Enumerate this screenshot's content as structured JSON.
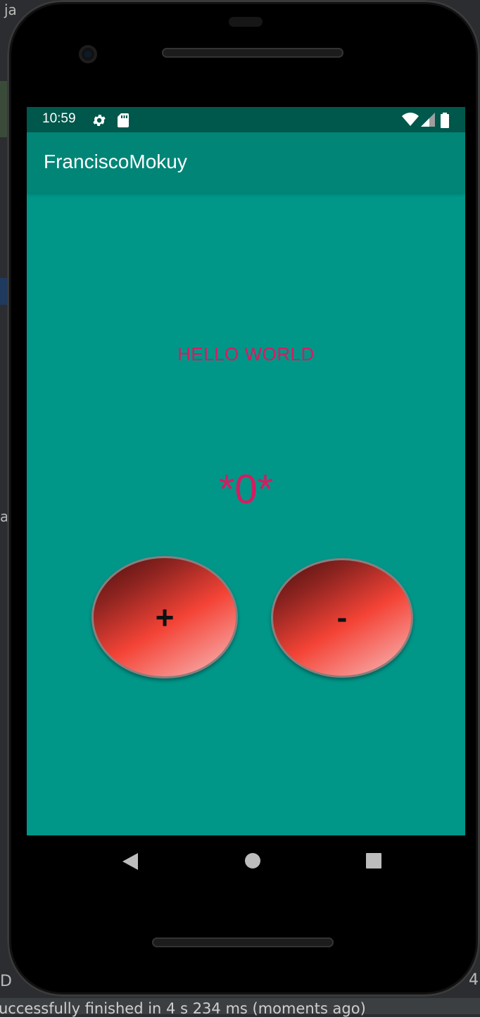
{
  "ide": {
    "tab_fragment": "ja",
    "side_fragment": "a",
    "left_fragment": "D",
    "right_fragment": "4",
    "status_message": "uccessfully finished in 4 s 234 ms (moments ago)"
  },
  "statusbar": {
    "time": "10:59",
    "icons": [
      "settings-icon",
      "sd-card-icon",
      "wifi-icon",
      "cell-signal-icon",
      "battery-icon"
    ]
  },
  "app": {
    "title": "FranciscoMokuy",
    "hello_text": "HELLO WORLD",
    "counter": "*0*",
    "plus_label": "+",
    "minus_label": "-"
  },
  "navbar": {
    "buttons": [
      "back",
      "home",
      "recents"
    ]
  },
  "colors": {
    "screen_bg": "#009688",
    "appbar_bg": "#008577",
    "statusbar_bg": "#00574b",
    "accent_text": "#d81b60",
    "button_red": "#f44336"
  }
}
